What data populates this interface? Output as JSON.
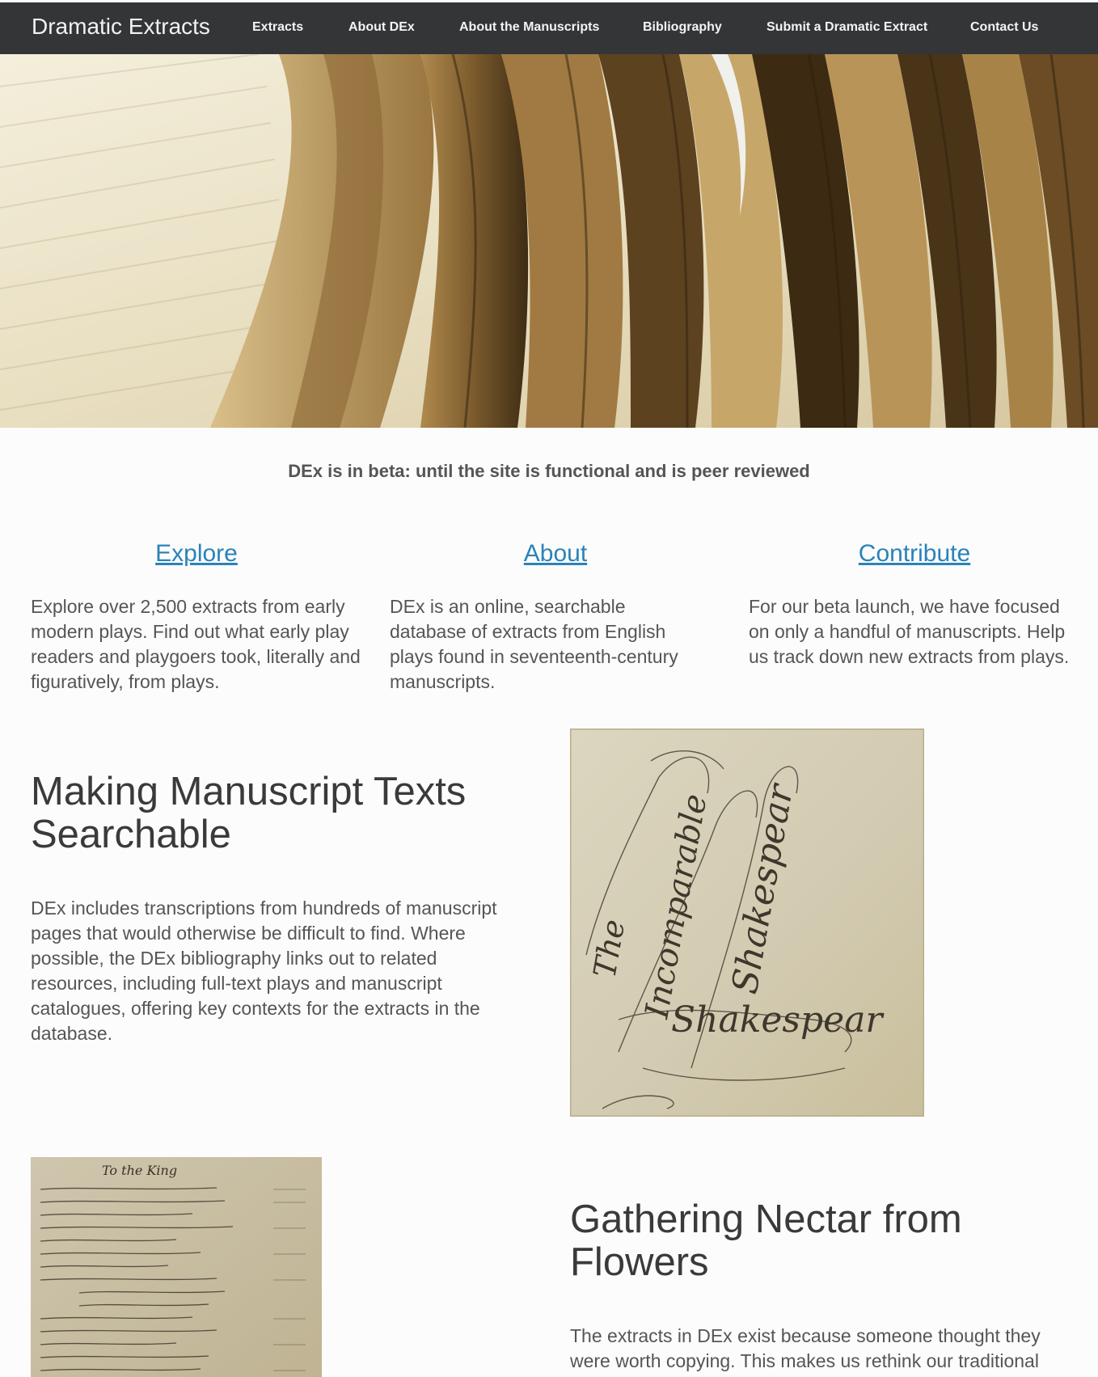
{
  "nav": {
    "brand": "Dramatic Extracts",
    "items": [
      "Extracts",
      "About DEx",
      "About the Manuscripts",
      "Bibliography",
      "Submit a Dramatic Extract",
      "Contact Us"
    ]
  },
  "beta_notice": "DEx is in beta: until the site is functional and is peer reviewed",
  "columns": [
    {
      "title": "Explore",
      "text": "Explore over 2,500 extracts from early modern plays. Find out what early play readers and playgoers took, literally and figuratively, from plays."
    },
    {
      "title": "About",
      "text": "DEx is an online, searchable database of extracts from English plays found in seventeenth-century manuscripts."
    },
    {
      "title": "Contribute",
      "text": "For our beta launch, we have focused on only a handful of manuscripts. Help us track down new extracts from plays."
    }
  ],
  "section1": {
    "heading": "Making Manuscript Texts Searchable",
    "text": "DEx includes transcriptions from hundreds of manuscript pages that would otherwise be difficult to find. Where possible, the DEx bibliography links out to related resources, including full-text plays and manuscript catalogues, offering key contexts for the extracts in the database.",
    "image_words": [
      "The",
      "Incomparable",
      "Shakespear",
      "Shakespear"
    ]
  },
  "section2": {
    "heading": "Gathering Nectar from Flowers",
    "text": "The extracts in DEx exist because someone thought they were worth copying. This makes us rethink our traditional",
    "image_caption_word": "To the King"
  }
}
